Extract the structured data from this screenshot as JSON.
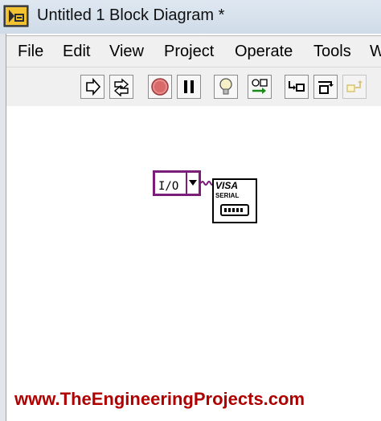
{
  "window": {
    "title": "Untitled 1 Block Diagram *"
  },
  "menu": {
    "items": [
      {
        "label": "File"
      },
      {
        "label": "Edit"
      },
      {
        "label": "View"
      },
      {
        "label": "Project"
      },
      {
        "label": "Operate"
      },
      {
        "label": "Tools"
      },
      {
        "label": "W"
      }
    ]
  },
  "toolbar": {
    "buttons": [
      {
        "icon": "run-arrow-icon"
      },
      {
        "icon": "run-continuously-icon"
      },
      {
        "icon": "abort-execution-icon"
      },
      {
        "icon": "pause-icon"
      },
      {
        "icon": "highlight-execution-bulb-icon"
      },
      {
        "icon": "retain-wire-values-icon"
      },
      {
        "icon": "step-into-icon"
      },
      {
        "icon": "step-over-icon"
      },
      {
        "icon": "step-out-icon"
      }
    ]
  },
  "diagram": {
    "io_constant": {
      "label": "I/O"
    },
    "visa_node": {
      "line1": "VISA",
      "line2": "SERIAL"
    }
  },
  "watermark": {
    "text": "www.TheEngineeringProjects.com"
  },
  "colors": {
    "visa_purple": "#7a1e7a",
    "watermark_red": "#b00000",
    "titlebar": "#d8e3ee"
  }
}
